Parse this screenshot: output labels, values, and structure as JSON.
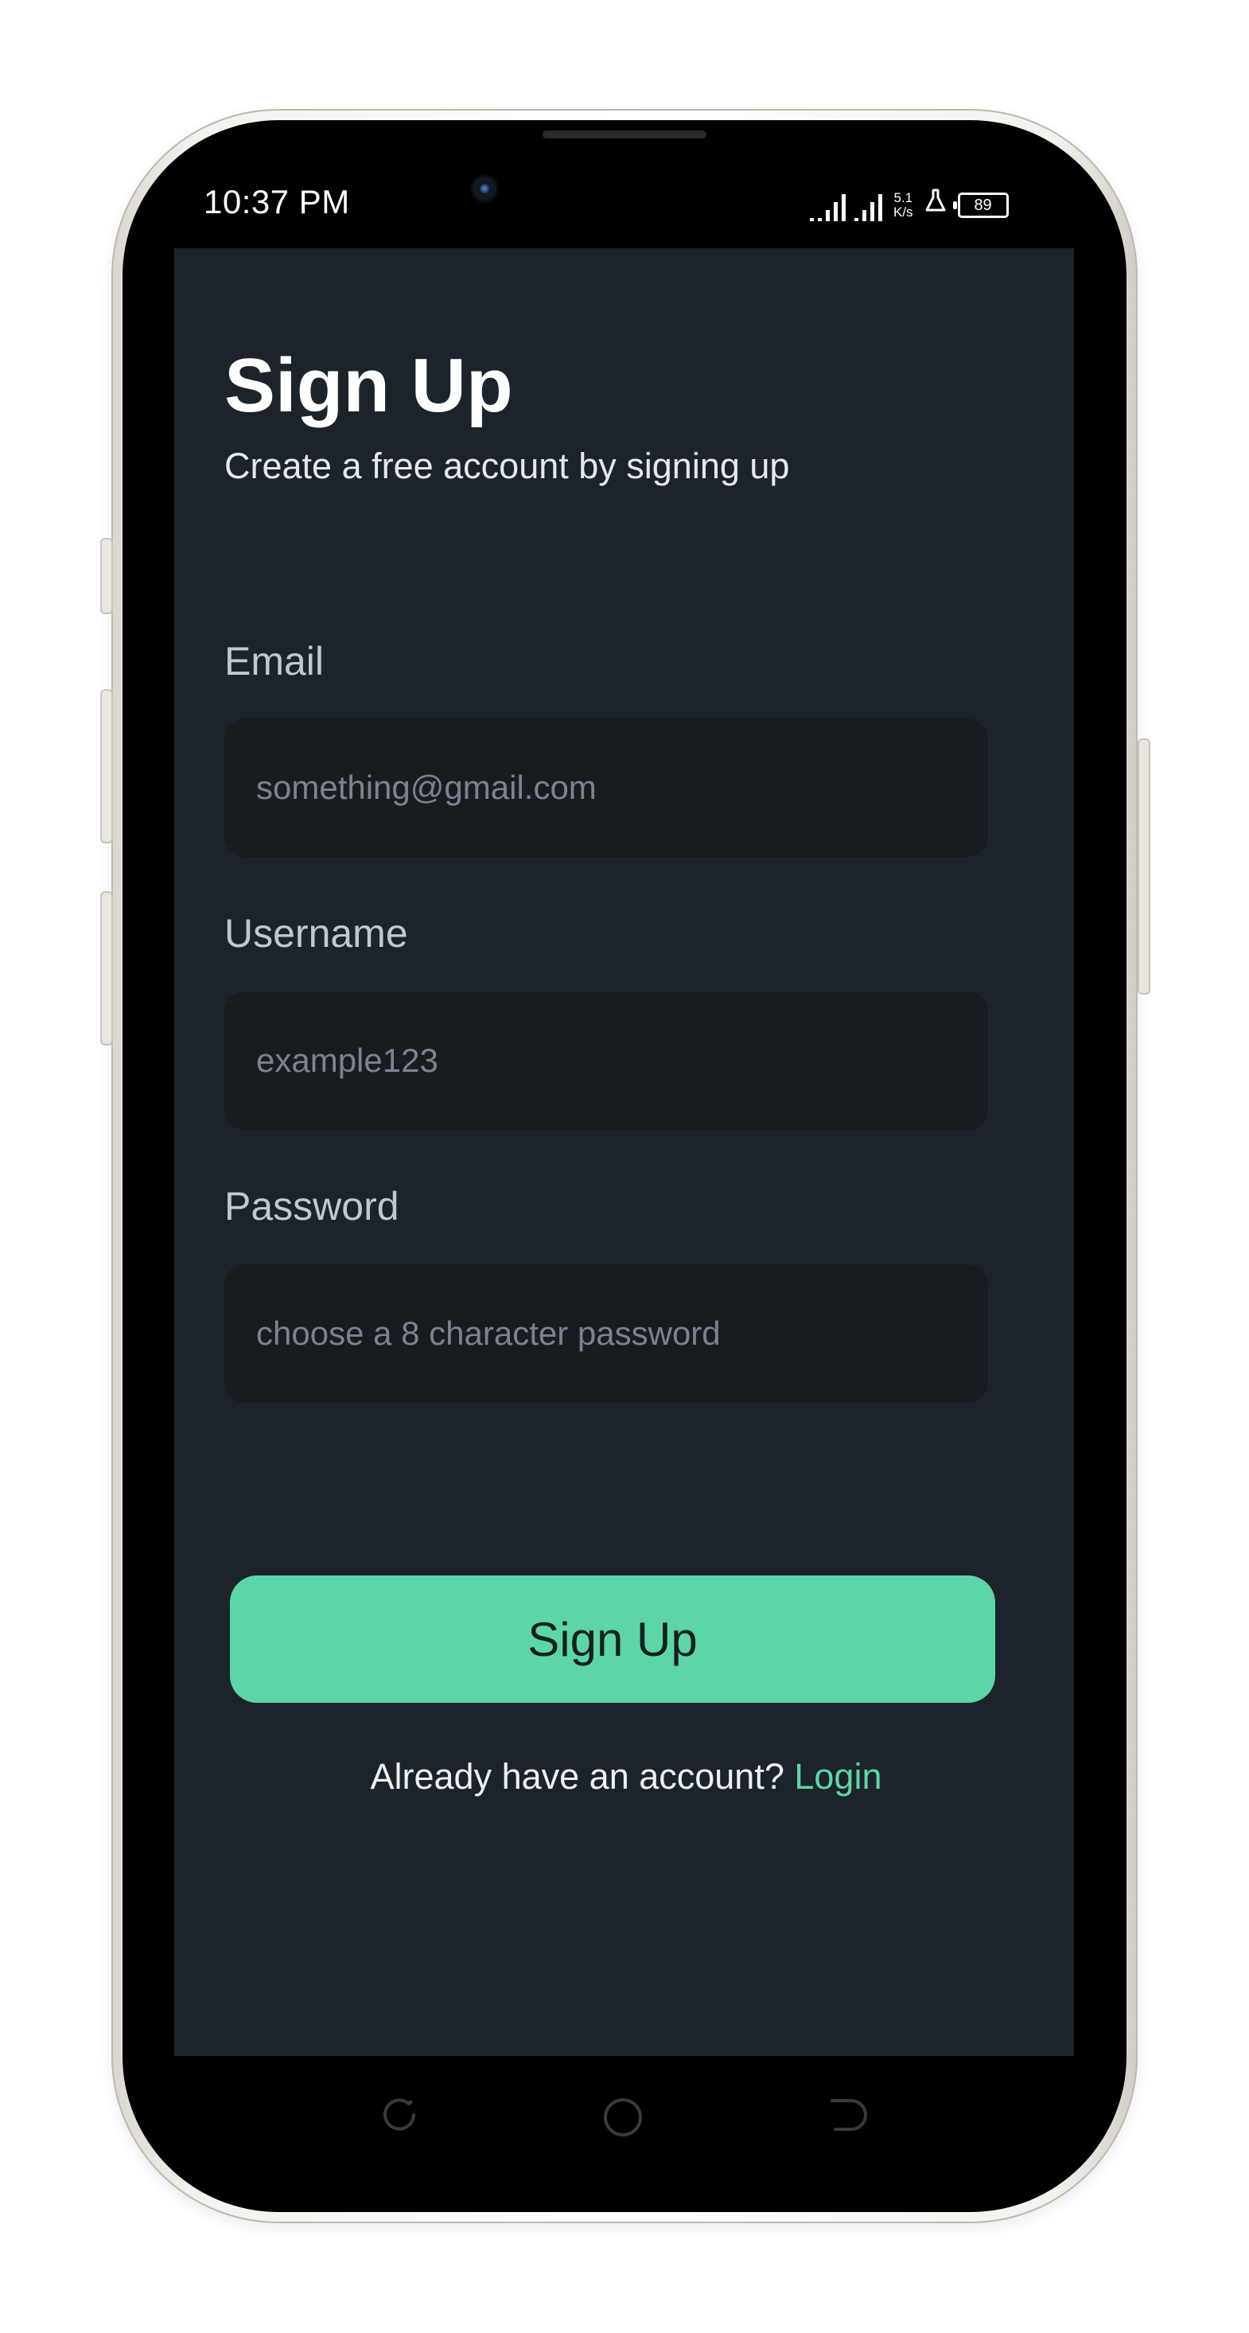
{
  "status_bar": {
    "time": "10:37 PM",
    "net_speed_value": "5.1",
    "net_speed_unit": "K/s",
    "battery": "89"
  },
  "page": {
    "title": "Sign Up",
    "subtitle": "Create a free account by signing up"
  },
  "form": {
    "email": {
      "label": "Email",
      "placeholder": "something@gmail.com"
    },
    "username": {
      "label": "Username",
      "placeholder": "example123"
    },
    "password": {
      "label": "Password",
      "placeholder": "choose a 8 character password"
    },
    "submit_label": "Sign Up"
  },
  "footer": {
    "prompt": "Already have an account?",
    "login_label": "Login"
  },
  "nav_bar": {
    "icons": [
      "recents-icon",
      "home-icon",
      "back-icon"
    ]
  },
  "colors": {
    "screen_bg": "#1c232a",
    "input_bg": "#181c20",
    "accent": "#5cd6a6"
  }
}
